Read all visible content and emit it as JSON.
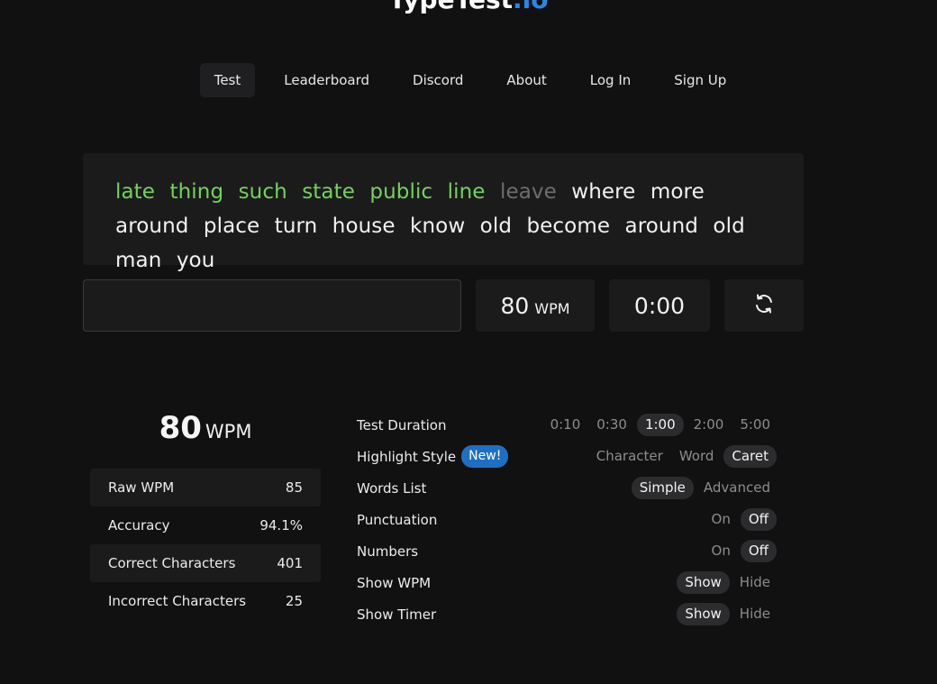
{
  "brand": {
    "name_main": "TypeTest",
    "name_accent": ".io"
  },
  "nav": [
    {
      "label": "Test",
      "active": true
    },
    {
      "label": "Leaderboard"
    },
    {
      "label": "Discord"
    },
    {
      "label": "About"
    },
    {
      "label": "Log In"
    },
    {
      "label": "Sign Up"
    }
  ],
  "typing_text": {
    "done_words": [
      "late",
      "thing",
      "such",
      "state",
      "public",
      "line"
    ],
    "current_word": "leave",
    "pending_words": [
      "where",
      "more",
      "around",
      "place",
      "turn",
      "house",
      "know",
      "old",
      "become",
      "around",
      "old",
      "man",
      "you"
    ]
  },
  "input": {
    "value": "",
    "placeholder": ""
  },
  "live_wpm": {
    "value": "80",
    "unit": "WPM"
  },
  "timer": "0:00",
  "reset_icon": "refresh-icon",
  "results": {
    "wpm": "80",
    "wpm_unit": "WPM",
    "rows": [
      {
        "label": "Raw WPM",
        "value": "85"
      },
      {
        "label": "Accuracy",
        "value": "94.1%"
      },
      {
        "label": "Correct Characters",
        "value": "401"
      },
      {
        "label": "Incorrect Characters",
        "value": "25"
      }
    ]
  },
  "settings": {
    "test_duration": {
      "label": "Test Duration",
      "options": [
        "0:10",
        "0:30",
        "1:00",
        "2:00",
        "5:00"
      ],
      "selected": "1:00"
    },
    "highlight_style": {
      "label": "Highlight Style",
      "badge": "New!",
      "options": [
        "Character",
        "Word",
        "Caret"
      ],
      "selected": "Caret"
    },
    "words_list": {
      "label": "Words List",
      "options": [
        "Simple",
        "Advanced"
      ],
      "selected": "Simple"
    },
    "punctuation": {
      "label": "Punctuation",
      "options": [
        "On",
        "Off"
      ],
      "selected": "Off"
    },
    "numbers": {
      "label": "Numbers",
      "options": [
        "On",
        "Off"
      ],
      "selected": "Off"
    },
    "show_wpm": {
      "label": "Show WPM",
      "options": [
        "Show",
        "Hide"
      ],
      "selected": "Show"
    },
    "show_timer": {
      "label": "Show Timer",
      "options": [
        "Show",
        "Hide"
      ],
      "selected": "Show"
    }
  },
  "colors": {
    "background": "#111112",
    "panel": "#1b1b1c",
    "typed_correct": "#74d25a",
    "current_word": "#6e6e6e",
    "accent": "#2b86e0",
    "badge": "#1f6fc1"
  }
}
